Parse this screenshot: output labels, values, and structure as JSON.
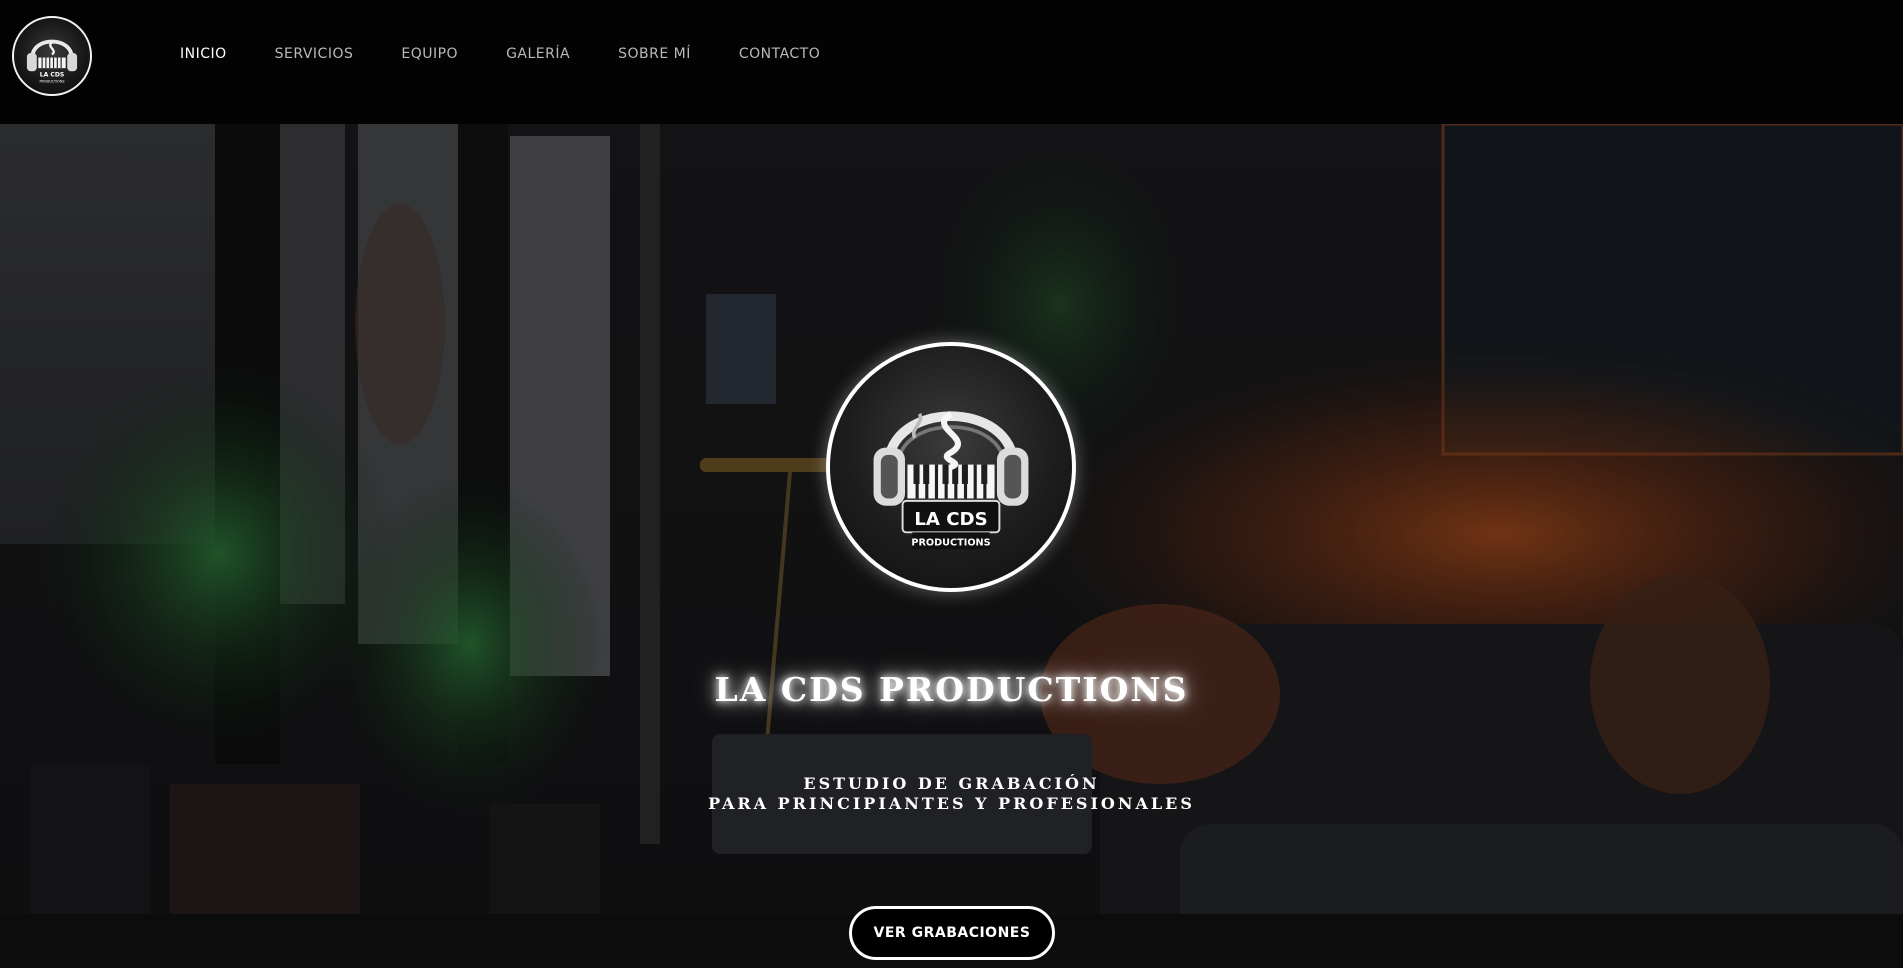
{
  "header": {
    "logo_text": "LA CDS",
    "logo_subtext": "PRODUCTIONS",
    "nav": [
      {
        "label": "INICIO",
        "active": true
      },
      {
        "label": "SERVICIOS",
        "active": false
      },
      {
        "label": "EQUIPO",
        "active": false
      },
      {
        "label": "GALERÍA",
        "active": false
      },
      {
        "label": "SOBRE MÍ",
        "active": false
      },
      {
        "label": "CONTACTO",
        "active": false
      }
    ]
  },
  "hero": {
    "logo_text": "LA CDS",
    "logo_subtext": "PRODUCTIONS",
    "title": "LA CDS PRODUCTIONS",
    "subtitle_line1": "ESTUDIO DE GRABACIÓN",
    "subtitle_line2": "PARA PRINCIPIANTES Y PROFESIONALES",
    "cta_label": "VER GRABACIONES"
  },
  "colors": {
    "header_bg": "#030303",
    "text": "#ffffff",
    "nav_inactive": "#b9b9b9",
    "accent_glow": "#c2541c"
  },
  "icons": {
    "logo_art": "headphones-piano-icon"
  }
}
